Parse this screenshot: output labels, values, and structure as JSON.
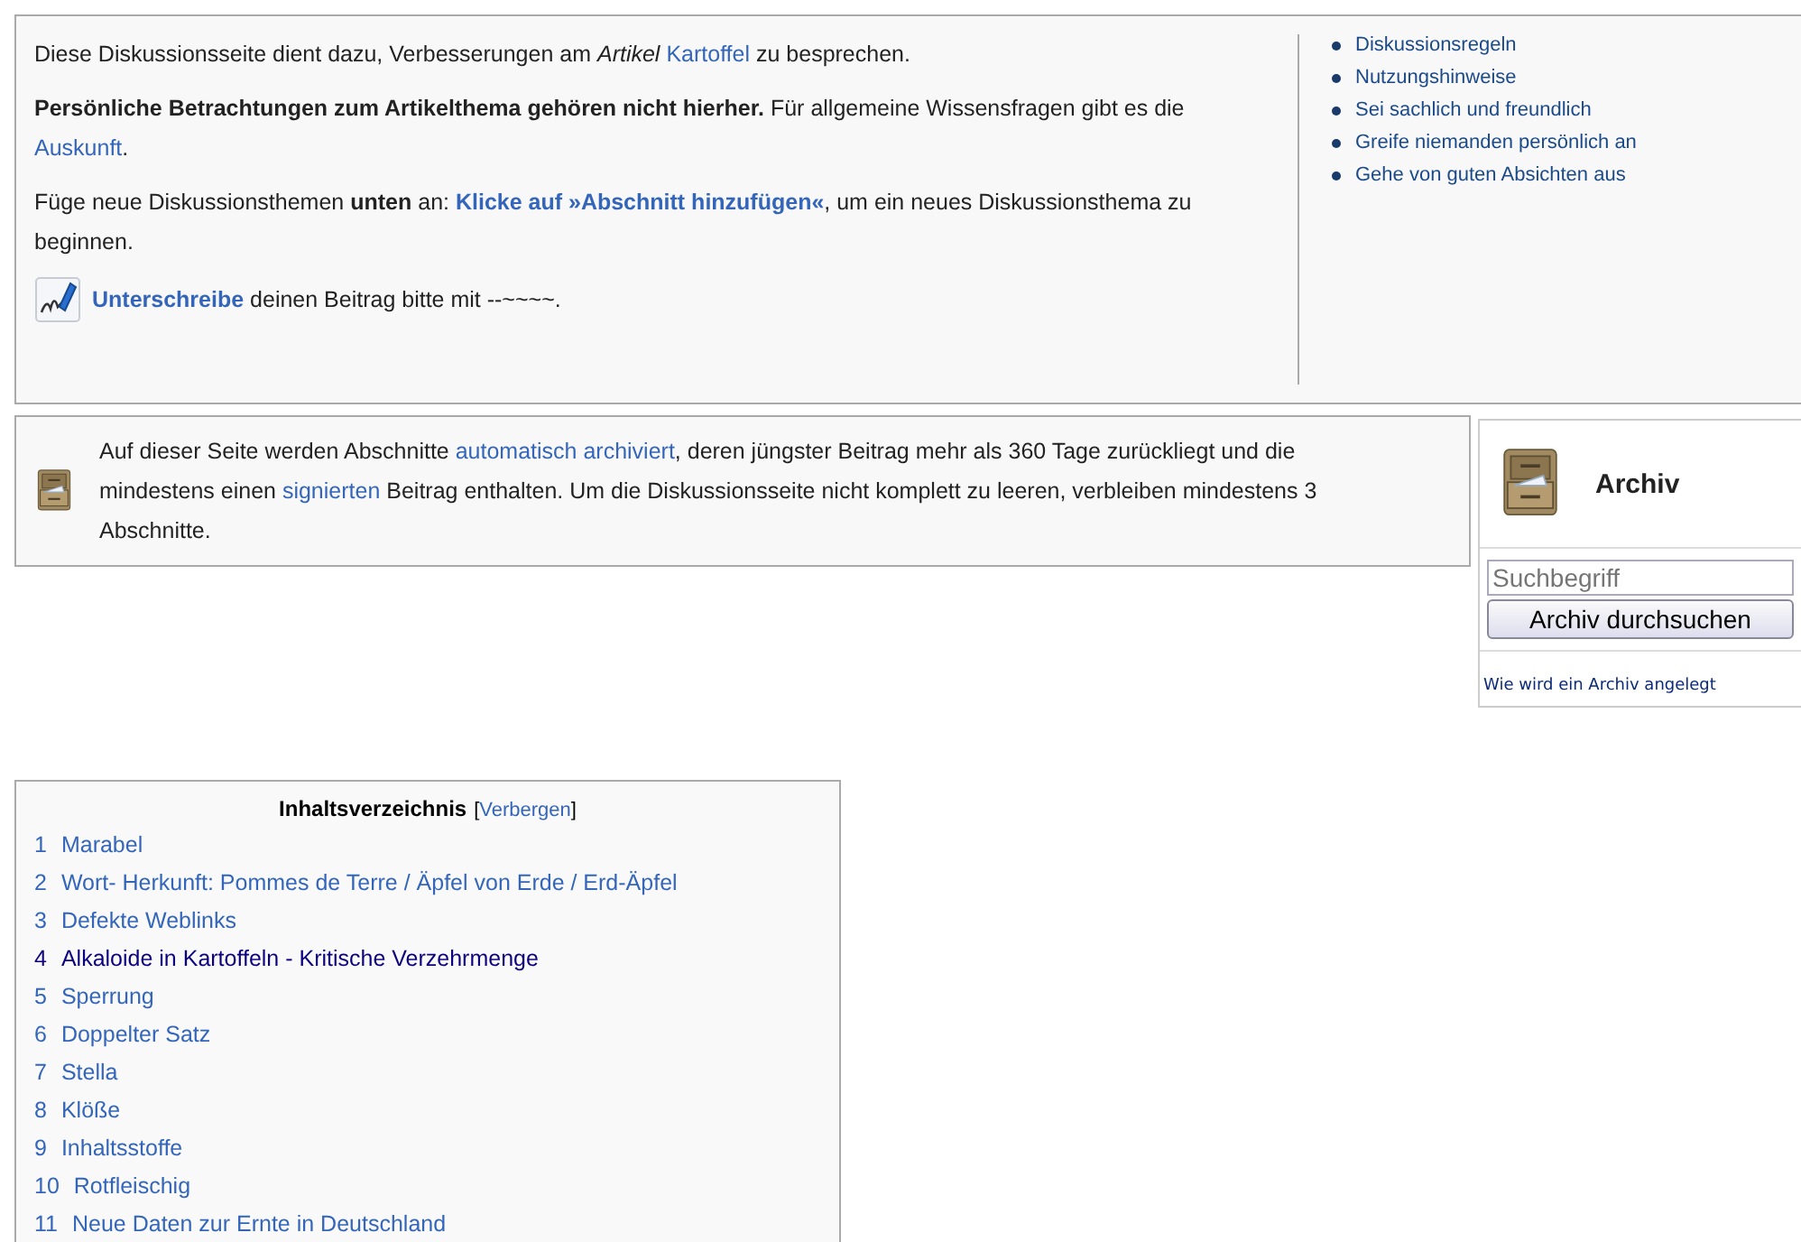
{
  "intro": {
    "paragraphs": [
      [
        {
          "kind": "plain",
          "text": "Diese Diskussionsseite dient dazu, Verbesserungen am "
        },
        {
          "kind": "italic",
          "text": "Artikel "
        },
        {
          "kind": "link",
          "text": "Kartoffel"
        },
        {
          "kind": "plain",
          "text": " zu besprechen."
        }
      ],
      [
        {
          "kind": "bold",
          "text": "Persönliche Betrachtungen zum Artikelthema gehören nicht hierher."
        },
        {
          "kind": "plain",
          "text": " Für allgemeine Wissensfragen gibt es die "
        },
        {
          "kind": "link",
          "text": "Auskunft"
        },
        {
          "kind": "plain",
          "text": "."
        }
      ],
      [
        {
          "kind": "plain",
          "text": "Füge neue Diskussionsthemen "
        },
        {
          "kind": "bold",
          "text": "unten"
        },
        {
          "kind": "plain",
          "text": " an: "
        },
        {
          "kind": "boldlink",
          "text": "Klicke auf »Abschnitt hinzufügen«"
        },
        {
          "kind": "plain",
          "text": ", um ein neues Diskussionsthema zu beginnen."
        }
      ]
    ],
    "signature": [
      {
        "kind": "boldlink",
        "text": "Unterschreibe"
      },
      {
        "kind": "plain",
        "text": " deinen Beitrag bitte mit "
      },
      {
        "kind": "plain",
        "text": "--~~~~."
      }
    ],
    "rules": [
      "Diskussionsregeln",
      "Nutzungshinweise",
      "Sei sachlich und freundlich",
      "Greife niemanden persönlich an",
      "Gehe von guten Absichten aus"
    ]
  },
  "archive_notice": [
    {
      "kind": "plain",
      "text": "Auf dieser Seite werden Abschnitte "
    },
    {
      "kind": "link",
      "text": "automatisch archiviert"
    },
    {
      "kind": "plain",
      "text": ", deren jüngster Beitrag mehr als 360 Tage zurückliegt und die mindestens einen "
    },
    {
      "kind": "link",
      "text": "signierten"
    },
    {
      "kind": "plain",
      "text": " Beitrag enthalten. Um die Diskussionsseite nicht komplett zu leeren, verbleiben mindestens 3 Abschnitte."
    }
  ],
  "archive_box": {
    "title": "Archiv",
    "search": {
      "placeholder": "Suchbegriff"
    },
    "button": "Archiv durchsuchen",
    "help_link": "Wie wird ein Archiv angelegt"
  },
  "toc": {
    "title": "Inhaltsverzeichnis",
    "toggle_open": "[",
    "toggle": "Verbergen",
    "toggle_close": "]",
    "items": [
      {
        "number": "1",
        "label": "Marabel",
        "visited": false
      },
      {
        "number": "2",
        "label": "Wort- Herkunft: Pommes de Terre / Äpfel von Erde / Erd-Äpfel",
        "visited": false
      },
      {
        "number": "3",
        "label": "Defekte Weblinks",
        "visited": false
      },
      {
        "number": "4",
        "label": "Alkaloide in Kartoffeln - Kritische Verzehrmenge",
        "visited": true
      },
      {
        "number": "5",
        "label": "Sperrung",
        "visited": false
      },
      {
        "number": "6",
        "label": "Doppelter Satz",
        "visited": false
      },
      {
        "number": "7",
        "label": "Stella",
        "visited": false
      },
      {
        "number": "8",
        "label": "Klöße",
        "visited": false
      },
      {
        "number": "9",
        "label": "Inhaltsstoffe",
        "visited": false
      },
      {
        "number": "10",
        "label": "Rotfleischig",
        "visited": false
      },
      {
        "number": "11",
        "label": "Neue Daten zur Ernte in Deutschland",
        "visited": false
      }
    ]
  }
}
